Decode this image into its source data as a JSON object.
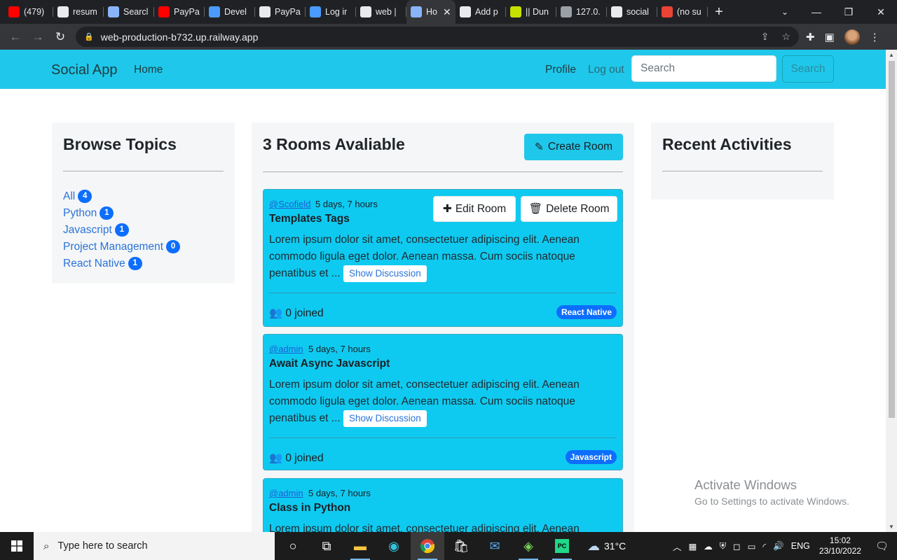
{
  "browser": {
    "tabs": [
      {
        "title": "(479)",
        "icon": "youtube-icon",
        "color": "#ff0000"
      },
      {
        "title": "resum",
        "icon": "github-icon",
        "color": "#e8eaed"
      },
      {
        "title": "Searcl",
        "icon": "flag-icon",
        "color": "#8ab4f8"
      },
      {
        "title": "PayPa",
        "icon": "youtube-icon",
        "color": "#ff0000"
      },
      {
        "title": "Devel",
        "icon": "paypal-icon",
        "color": "#4b9bff"
      },
      {
        "title": "PayPa",
        "icon": "globe-icon",
        "color": "#e8eaed"
      },
      {
        "title": "Log ir",
        "icon": "paypal-icon",
        "color": "#4b9bff"
      },
      {
        "title": "web |",
        "icon": "railway-icon",
        "color": "#e8eaed"
      },
      {
        "title": "Ho",
        "icon": "rocket-icon",
        "color": "#8ab4f8",
        "active": true
      },
      {
        "title": "Add p",
        "icon": "globe-icon",
        "color": "#e8eaed"
      },
      {
        "title": "|| Dun",
        "icon": "dun-icon",
        "color": "#c6e000"
      },
      {
        "title": "127.0.",
        "icon": "globe-icon",
        "color": "#9aa0a6"
      },
      {
        "title": "social",
        "icon": "github-icon",
        "color": "#e8eaed"
      },
      {
        "title": "(no su",
        "icon": "gmail-icon",
        "color": "#ea4335"
      }
    ],
    "url": "web-production-b732.up.railway.app"
  },
  "nav": {
    "brand": "Social App",
    "home": "Home",
    "profile": "Profile",
    "logout": "Log out",
    "search_placeholder": "Search",
    "search_button": "Search"
  },
  "topics": {
    "title": "Browse Topics",
    "items": [
      {
        "name": "All",
        "count": "4"
      },
      {
        "name": "Python",
        "count": "1"
      },
      {
        "name": "Javascript",
        "count": "1"
      },
      {
        "name": "Project Management",
        "count": "0"
      },
      {
        "name": "React Native",
        "count": "1"
      }
    ]
  },
  "rooms": {
    "title": "3 Rooms Avaliable",
    "create_label": "Create Room",
    "edit_label": "Edit Room",
    "delete_label": "Delete Room",
    "show_label": "Show Discussion",
    "items": [
      {
        "host": "@Scofield",
        "when": "5 days, 7 hours",
        "title": "Templates Tags",
        "desc": "Lorem ipsum dolor sit amet, consectetuer adipiscing elit. Aenean commodo ligula eget dolor. Aenean massa. Cum sociis natoque penatibus et ...",
        "joined": "0 joined",
        "topic": "React Native"
      },
      {
        "host": "@admin",
        "when": "5 days, 7 hours",
        "title": "Await Async Javascript",
        "desc": "Lorem ipsum dolor sit amet, consectetuer adipiscing elit. Aenean commodo ligula eget dolor. Aenean massa. Cum sociis natoque penatibus et ...",
        "joined": "0 joined",
        "topic": "Javascript"
      },
      {
        "host": "@admin",
        "when": "5 days, 7 hours",
        "title": "Class in Python",
        "desc": "Lorem ipsum dolor sit amet, consectetuer adipiscing elit. Aenean"
      }
    ]
  },
  "activities": {
    "title": "Recent Activities"
  },
  "watermark": {
    "line1": "Activate Windows",
    "line2": "Go to Settings to activate Windows."
  },
  "taskbar": {
    "search_placeholder": "Type here to search",
    "weather": "31°C",
    "lang": "ENG",
    "time": "15:02",
    "date": "23/10/2022"
  },
  "colors": {
    "accent": "#1fc8ea",
    "room_card": "#0fcaf0",
    "badge": "#0d6efd"
  }
}
